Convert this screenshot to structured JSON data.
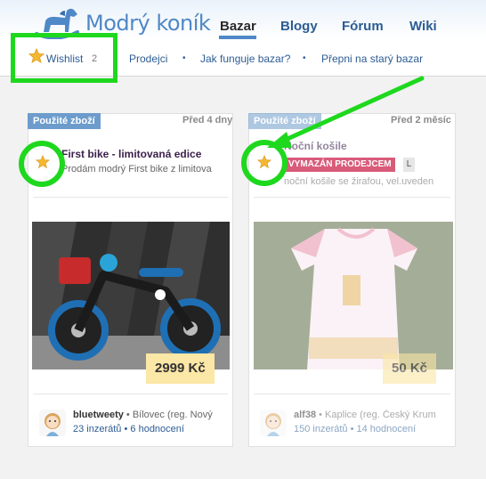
{
  "header": {
    "logo_text": "Modrý koník",
    "nav": [
      {
        "label": "Bazar",
        "active": true
      },
      {
        "label": "Blogy"
      },
      {
        "label": "Fórum"
      },
      {
        "label": "Wiki"
      }
    ]
  },
  "subnav": {
    "wishlist_label": "Wishlist",
    "wishlist_count": "2",
    "links": [
      "Prodejci",
      "Jak funguje bazar?",
      "Přepni na starý bazar"
    ],
    "separator": "•"
  },
  "listings": [
    {
      "category": "Použité zboží",
      "date": "Před 4 dny",
      "title": "First bike - limitovaná edice",
      "description": "Prodám modrý First bike z limitova",
      "price": "2999 Kč",
      "seller": "bluetweety",
      "location": "• Bílovec (reg. Nový",
      "ads": "23 inzerátů",
      "ratings": "6 hodnocení"
    },
    {
      "category": "Použité zboží",
      "date": "Před 2 měsíc",
      "title": "Noční košile",
      "badge": "VYMAZÁN PRODEJCEM",
      "size": "L",
      "description": "noční košile se žirafou, vel.uveden",
      "price": "50 Kč",
      "seller": "alf38",
      "location": "• Kaplice (reg. Český Krum",
      "ads": "150 inzerátů",
      "ratings": "14 hodnocení",
      "removed": true
    }
  ],
  "colors": {
    "brand_blue": "#4f88c6",
    "highlight_green": "#1ed81e",
    "price_bg": "#fbe7a6",
    "removed_badge": "#d95b7a"
  }
}
